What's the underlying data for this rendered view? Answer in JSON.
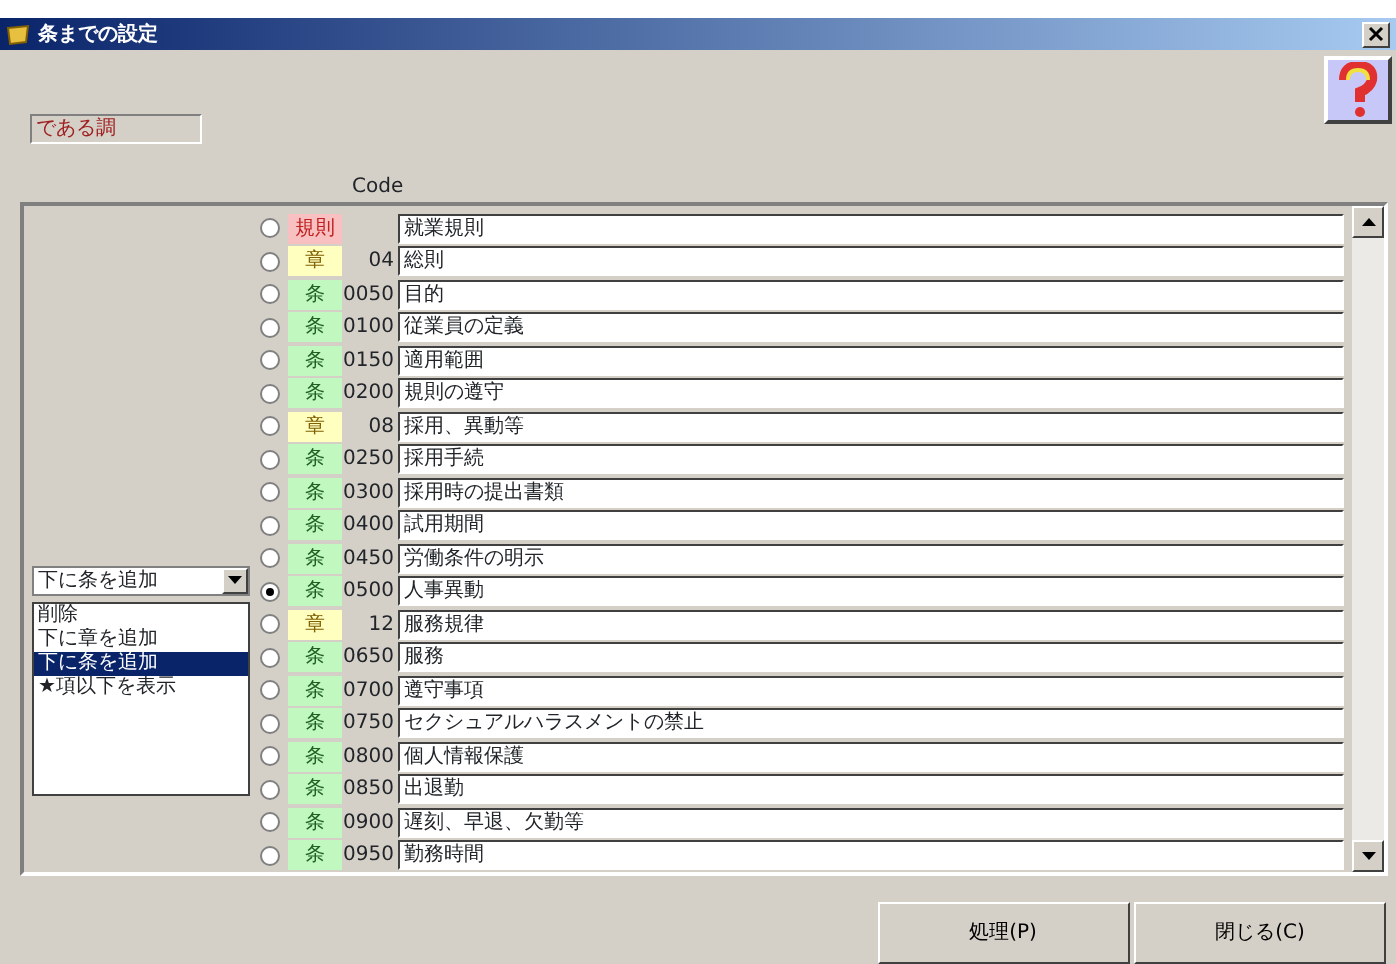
{
  "window": {
    "title": "条までの設定"
  },
  "style_label": "である調",
  "code_header": "Code",
  "action_dropdown": {
    "value": "下に条を追加"
  },
  "action_list": [
    {
      "label": "削除",
      "selected": false
    },
    {
      "label": "下に章を追加",
      "selected": false
    },
    {
      "label": "下に条を追加",
      "selected": true
    },
    {
      "label": "★項以下を表示",
      "selected": false
    }
  ],
  "rows": [
    {
      "kind": "rule",
      "tag": "規則",
      "code": "",
      "name": "就業規則",
      "selected": false
    },
    {
      "kind": "chapter",
      "tag": "章",
      "code": "04",
      "name": "総則",
      "selected": false
    },
    {
      "kind": "article",
      "tag": "条",
      "code": "0050",
      "name": "目的",
      "selected": false
    },
    {
      "kind": "article",
      "tag": "条",
      "code": "0100",
      "name": "従業員の定義",
      "selected": false
    },
    {
      "kind": "article",
      "tag": "条",
      "code": "0150",
      "name": "適用範囲",
      "selected": false
    },
    {
      "kind": "article",
      "tag": "条",
      "code": "0200",
      "name": "規則の遵守",
      "selected": false
    },
    {
      "kind": "chapter",
      "tag": "章",
      "code": "08",
      "name": "採用、異動等",
      "selected": false
    },
    {
      "kind": "article",
      "tag": "条",
      "code": "0250",
      "name": "採用手続",
      "selected": false
    },
    {
      "kind": "article",
      "tag": "条",
      "code": "0300",
      "name": "採用時の提出書類",
      "selected": false
    },
    {
      "kind": "article",
      "tag": "条",
      "code": "0400",
      "name": "試用期間",
      "selected": false
    },
    {
      "kind": "article",
      "tag": "条",
      "code": "0450",
      "name": "労働条件の明示",
      "selected": false
    },
    {
      "kind": "article",
      "tag": "条",
      "code": "0500",
      "name": "人事異動",
      "selected": true
    },
    {
      "kind": "chapter",
      "tag": "章",
      "code": "12",
      "name": "服務規律",
      "selected": false
    },
    {
      "kind": "article",
      "tag": "条",
      "code": "0650",
      "name": "服務",
      "selected": false
    },
    {
      "kind": "article",
      "tag": "条",
      "code": "0700",
      "name": "遵守事項",
      "selected": false
    },
    {
      "kind": "article",
      "tag": "条",
      "code": "0750",
      "name": "セクシュアルハラスメントの禁止",
      "selected": false
    },
    {
      "kind": "article",
      "tag": "条",
      "code": "0800",
      "name": "個人情報保護",
      "selected": false
    },
    {
      "kind": "article",
      "tag": "条",
      "code": "0850",
      "name": "出退勤",
      "selected": false
    },
    {
      "kind": "article",
      "tag": "条",
      "code": "0900",
      "name": "遅刻、早退、欠勤等",
      "selected": false
    },
    {
      "kind": "article",
      "tag": "条",
      "code": "0950",
      "name": "勤務時間",
      "selected": false
    }
  ],
  "buttons": [
    "処理(P)",
    "閉じる(C)"
  ]
}
